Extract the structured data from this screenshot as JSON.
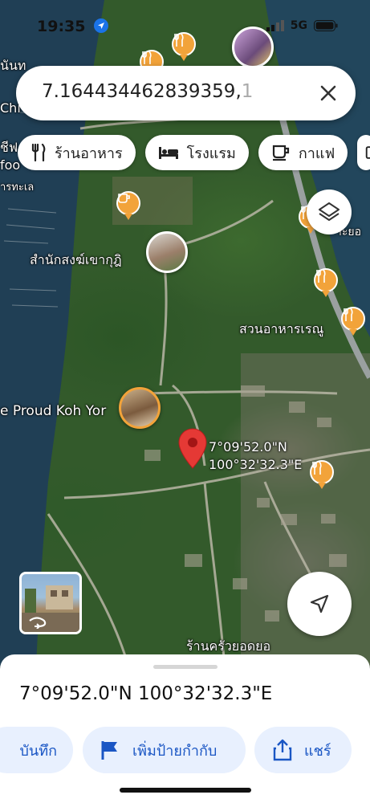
{
  "status_bar": {
    "time": "19:35",
    "network": "5G"
  },
  "search": {
    "query_main": "7.164434462839359,",
    "query_faded": "1",
    "close_icon": "close-icon"
  },
  "chips": [
    {
      "label": "ร้านอาหาร",
      "icon": "restaurant-icon"
    },
    {
      "label": "โรงแรม",
      "icon": "hotel-icon"
    },
    {
      "label": "กาแฟ",
      "icon": "coffee-icon"
    }
  ],
  "map": {
    "labels": {
      "temple": "สำนักสงฆ์เขากุฎิ",
      "restaurant_right": "สวนอาหารเรณู",
      "hotel": "e Proud Koh Yor",
      "bottom_restaurant": "ร้านครัวยอดยอ",
      "edge_top": "นันท",
      "edge_chi": "Chi",
      "edge_mid": "ชีฟ",
      "edge_foo": "foo",
      "edge_sea": "ารทะเล",
      "edge_right": "าะยอ"
    },
    "pin_coordinates": {
      "line1": "7°09'52.0\"N",
      "line2": "100°32'32.3\"E"
    },
    "pin_color": "#e53935",
    "poi_color": "#f2a33a"
  },
  "sheet": {
    "title": "7°09'52.0\"N 100°32'32.3\"E",
    "actions": [
      {
        "label": "บันทึก",
        "icon": "save-icon"
      },
      {
        "label": "เพิ่มป้ายกำกับ",
        "icon": "flag-icon"
      },
      {
        "label": "แชร์",
        "icon": "share-icon"
      }
    ]
  },
  "colors": {
    "accent": "#1a56c4",
    "action_bg": "#e8f0fe"
  }
}
